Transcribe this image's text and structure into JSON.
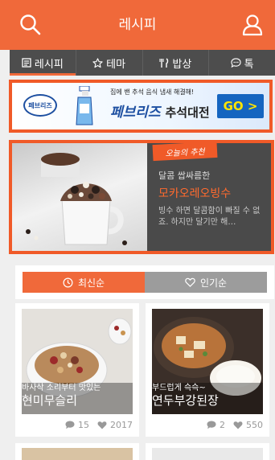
{
  "header": {
    "title": "레시피"
  },
  "tabs": [
    {
      "label": "레시피",
      "icon": "book-icon",
      "active": true
    },
    {
      "label": "테마",
      "icon": "star-icon",
      "active": false
    },
    {
      "label": "밥상",
      "icon": "utensils-icon",
      "active": false
    },
    {
      "label": "톡",
      "icon": "chat-icon",
      "active": false
    }
  ],
  "ad": {
    "logo": "페브리즈",
    "top_text": "집에 밴 추석 음식 냄새 해결해!",
    "brand": "페브리즈",
    "headline": "추석대전",
    "button": "GO >"
  },
  "feature": {
    "badge": "오늘의 추천",
    "subtitle": "달콤 쌉싸름한",
    "title": "모카오레오빙수",
    "description": "빙수 하면 달콤함이 빠질 수 없죠. 하지만 달기만 해…"
  },
  "sort": {
    "latest": "최신순",
    "popular": "인기순",
    "active": "latest"
  },
  "cards": [
    {
      "subtitle": "바사삭 소리부터 맛있는",
      "title": "현미무슬리",
      "comments": "15",
      "likes": "2017"
    },
    {
      "subtitle": "부드럽게 슥슥~",
      "title": "연두부강된장",
      "comments": "2",
      "likes": "550"
    }
  ],
  "colors": {
    "accent": "#f0693a",
    "tabbar": "#4d4d4d",
    "highlight": "#f05a28"
  }
}
